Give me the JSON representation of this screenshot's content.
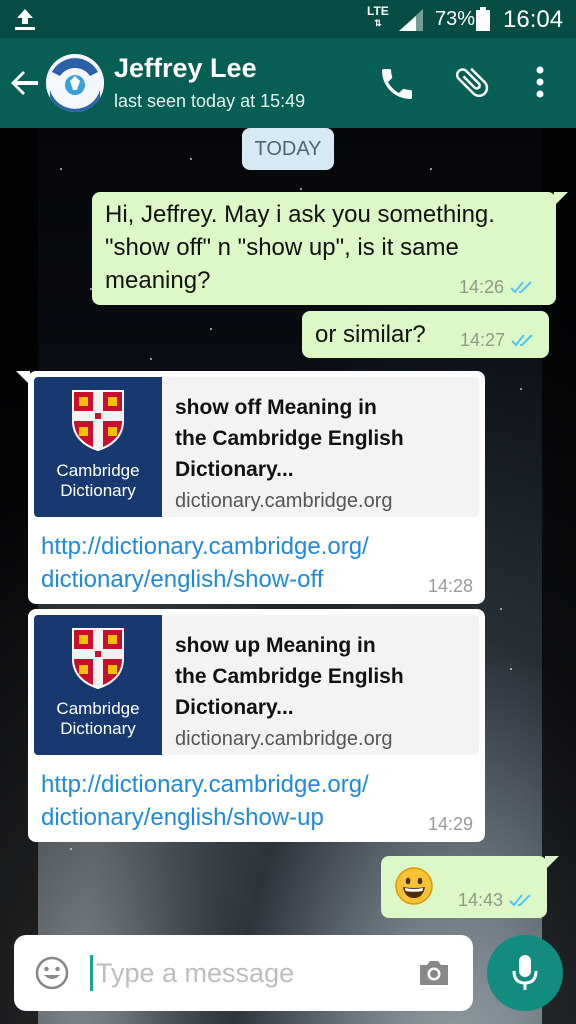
{
  "status_bar": {
    "network": "LTE",
    "battery_percent": "73%",
    "time": "16:04",
    "icons": [
      "upload-icon",
      "signal-icon",
      "battery-icon"
    ]
  },
  "header": {
    "contact_name": "Jeffrey Lee",
    "last_seen": "last seen today at 15:49",
    "icons": [
      "back-arrow-icon",
      "phone-icon",
      "paperclip-icon",
      "more-vert-icon"
    ]
  },
  "day_divider": "TODAY",
  "messages": [
    {
      "direction": "outgoing",
      "text": "Hi, Jeffrey. May i ask you something. \"show off\" n \"show up\", is it same meaning?",
      "time": "14:26",
      "status": "read"
    },
    {
      "direction": "outgoing",
      "text": "or similar?",
      "time": "14:27",
      "status": "read"
    },
    {
      "direction": "incoming",
      "preview_title_l1": "show off Meaning in",
      "preview_title_l2": "the Cambridge English",
      "preview_title_l3": "Dictionary...",
      "preview_domain": "dictionary.cambridge.org",
      "thumb_brand_l1": "Cambridge",
      "thumb_brand_l2": "Dictionary",
      "link_l1": "http://dictionary.cambridge.org/",
      "link_l2": "dictionary/english/show-off",
      "time": "14:28"
    },
    {
      "direction": "incoming",
      "preview_title_l1": "show up Meaning in",
      "preview_title_l2": "the Cambridge English",
      "preview_title_l3": "Dictionary...",
      "preview_domain": "dictionary.cambridge.org",
      "thumb_brand_l1": "Cambridge",
      "thumb_brand_l2": "Dictionary",
      "link_l1": "http://dictionary.cambridge.org/",
      "link_l2": "dictionary/english/show-up",
      "time": "14:29"
    },
    {
      "direction": "outgoing",
      "emoji": "grinning-face-emoji",
      "time": "14:43",
      "status": "read"
    }
  ],
  "composer": {
    "placeholder": "Type a message",
    "value": "",
    "icons": [
      "emoji-icon",
      "camera-icon",
      "microphone-icon"
    ]
  },
  "colors": {
    "header": "#075e54",
    "status_bar": "#054d44",
    "outgoing_bubble": "#dcf8c6",
    "incoming_bubble": "#ffffff",
    "link": "#1e8ad8",
    "read_ticks": "#4fc3f7",
    "mic_button": "#128c7e"
  }
}
